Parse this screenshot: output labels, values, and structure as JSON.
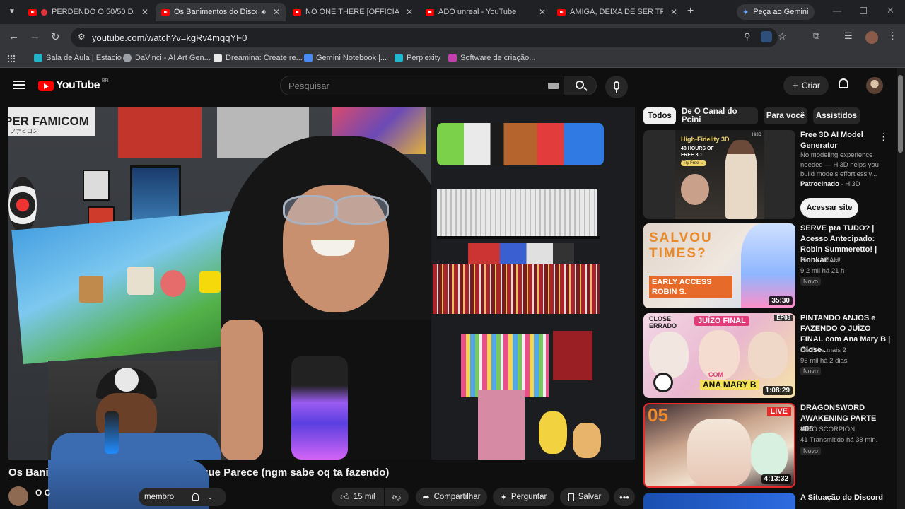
{
  "tabs": [
    {
      "title": "PERDENDO O 50/50 DA C",
      "active": false
    },
    {
      "title": "Os Banimentos do Disco",
      "active": true
    },
    {
      "title": "NO ONE THERE [OFFICIAL] -",
      "active": false
    },
    {
      "title": "ADO unreal - YouTube",
      "active": false
    },
    {
      "title": "AMIGA, DEIXA DE SER TROU",
      "active": false
    }
  ],
  "gemini_button": "Peça ao Gemini",
  "url": "youtube.com/watch?v=kgRv4mqqYF0",
  "bookmarks": [
    {
      "label": "Sala de Aula | Estacio",
      "color": "#23b3c7"
    },
    {
      "label": "DaVinci - AI Art Gen...",
      "color": "#9aa0a6"
    },
    {
      "label": "Dreamina: Create re...",
      "color": "#e8e8e8"
    },
    {
      "label": "Gemini Notebook |...",
      "color": "#4a8af4"
    },
    {
      "label": "Perplexity",
      "color": "#20b8cd"
    },
    {
      "label": "Software de criação...",
      "color": "#c23fb0"
    }
  ],
  "youtube": {
    "logo_text": "YouTube",
    "region": "BR",
    "search_placeholder": "Pesquisar",
    "create_label": "Criar"
  },
  "video": {
    "title": "Os Banim",
    "title_rest": "o que Parece (ngm sabe oq ta fazendo)",
    "channel_initial": "O C",
    "member_label": "membro",
    "likes": "15 mil",
    "share_label": "Compartilhar",
    "ask_label": "Perguntar",
    "save_label": "Salvar",
    "poster_text": "PER FAMICOM",
    "poster_jp": "ファミコン"
  },
  "chips": [
    "Todos",
    "De O Canal do Pcini",
    "Para você",
    "Assistidos"
  ],
  "ad": {
    "thumb_headline": "High-Fidelity 3D",
    "thumb_sub": "48 HOURS OF FREE 3D",
    "thumb_btn": "Try Free →",
    "thumb_brand": "Hi3D",
    "title": "Free 3D AI Model Generator",
    "desc": "No modeling experience needed — Hi3D helps you build models effortlessly...",
    "sponsor": "Patrocinado",
    "sponsor_name": "Hi3D",
    "cta": "Acessar site"
  },
  "recommendations": [
    {
      "title": "SERVE pra TUDO? | Acesso Antecipado: Robin Summeretto! | Honkai: ...",
      "channel": "BarbarYEAH!",
      "meta": "9,2 mil  há 21 h",
      "badge": "Novo",
      "duration": "35:30",
      "thumb_top": "SALVOU TIMES?",
      "thumb_bottom": "EARLY ACCESS ROBIN S."
    },
    {
      "title": "PINTANDO ANJOS e FAZENDO O JUÍZO FINAL com Ana Mary B | Close ...",
      "channel": "DiaTV  e mais 2",
      "meta": "95 mil  há 2 dias",
      "badge": "Novo",
      "duration": "1:08:29",
      "thumb_top": "JUÍZO FINAL",
      "thumb_corner": "CLOSE ERRADO",
      "thumb_ep": "EP08",
      "thumb_bottom": "ANA MARY B",
      "thumb_com": "COM"
    },
    {
      "title": "DRAGONSWORD AWAKENING PARTE #05",
      "channel": "NIRO SCORPION",
      "meta": "41  Transmitido há 38 min.",
      "badge": "Novo",
      "duration": "4:13:32",
      "thumb_num": "05",
      "thumb_live": "LIVE"
    },
    {
      "title": "A Situação do Discord"
    }
  ]
}
